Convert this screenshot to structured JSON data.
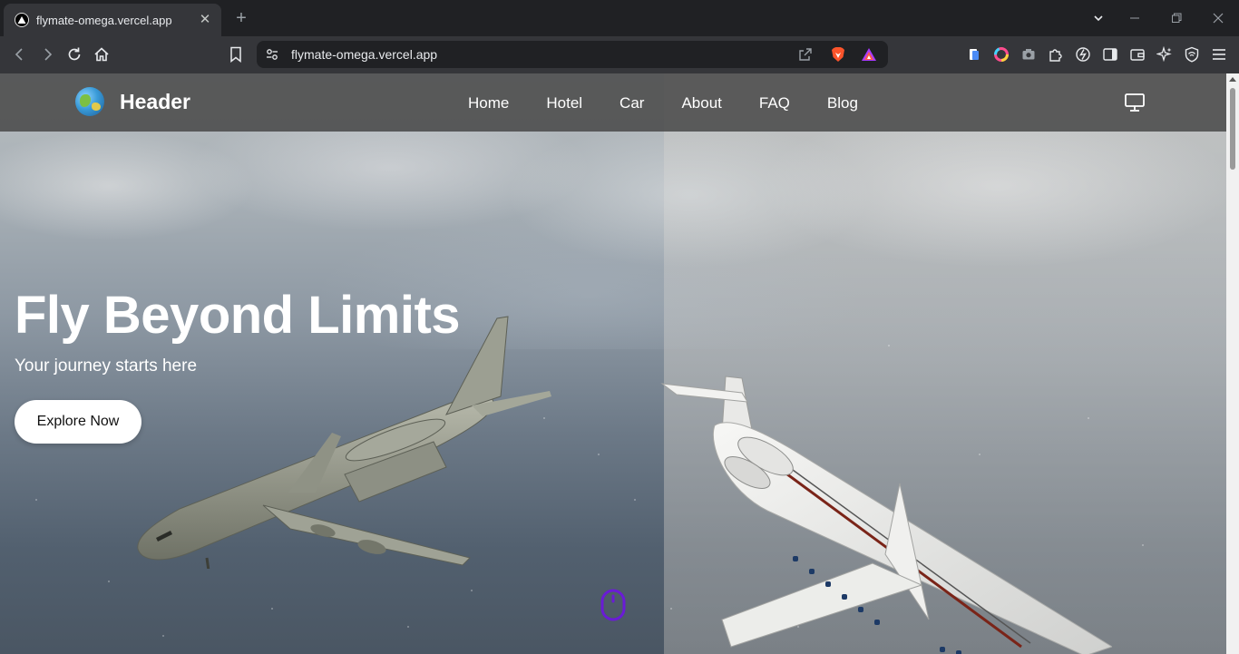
{
  "browser": {
    "tab_title": "flymate-omega.vercel.app",
    "tab_close": "✕",
    "new_tab": "+",
    "url": "flymate-omega.vercel.app"
  },
  "site": {
    "brand": "Header",
    "nav": [
      "Home",
      "Hotel",
      "Car",
      "About",
      "FAQ",
      "Blog"
    ],
    "accent": "#6a1bd6"
  },
  "hero": {
    "title": "Fly Beyond Limits",
    "subtitle": "Your journey starts here",
    "cta": "Explore Now"
  },
  "icons": {
    "theme_toggle": "monitor-icon",
    "scroll_indicator": "mouse-icon"
  }
}
